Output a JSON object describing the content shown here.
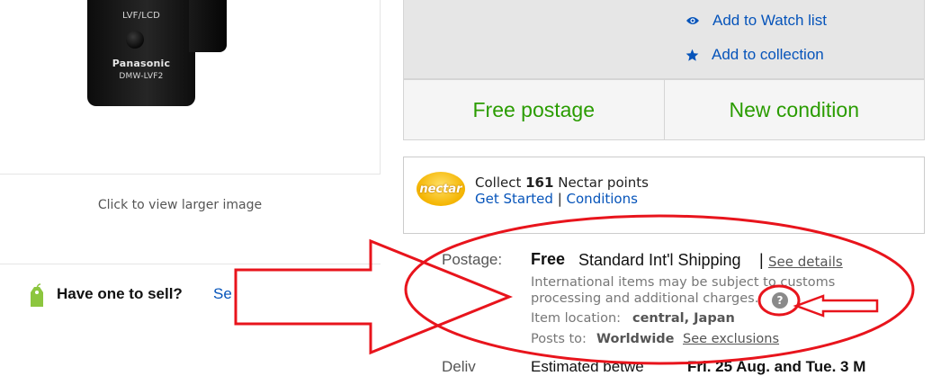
{
  "product_image": {
    "brand_text": "Panasonic",
    "model_text": "DMW-LVF2",
    "switch_text": "LVF/LCD",
    "caption": "Click to view larger image"
  },
  "sell": {
    "question": "Have one to sell?",
    "link_partial": "Se"
  },
  "actions": {
    "watch_label": "Add to Watch list",
    "collection_label": "Add to collection"
  },
  "features": {
    "postage": "Free postage",
    "condition": "New condition"
  },
  "nectar": {
    "logo_text": "nectar",
    "collect_prefix": "Collect",
    "points_value": "161",
    "collect_suffix": "Nectar points",
    "get_started": "Get Started",
    "separator": "|",
    "conditions": "Conditions"
  },
  "shipping": {
    "label": "Postage:",
    "free": "Free",
    "service": "Standard Int'l Shipping",
    "separator": "|",
    "see_details": "See details",
    "customs_note": "International items may be subject to customs processing and additional charges.",
    "help_icon": "?",
    "location_label": "Item location:",
    "location_value": "central, Japan",
    "posts_to_label": "Posts to:",
    "posts_to_value": "Worldwide",
    "see_exclusions": "See exclusions"
  },
  "delivery_cutoff": {
    "label": "Deliv",
    "text": "Estimated betwe",
    "bold": "Fri. 25 Aug. and Tue. 3 M"
  },
  "colors": {
    "link": "#0654ba",
    "feature_green": "#2a9c00",
    "annotation_red": "#e8141c"
  }
}
